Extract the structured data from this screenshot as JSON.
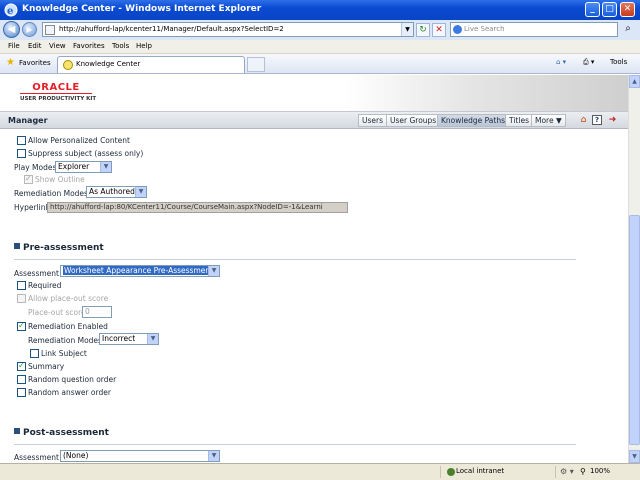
{
  "window": {
    "title": "Knowledge Center - Windows Internet Explorer",
    "min_label": "_",
    "max_label": "□",
    "close_label": "✕"
  },
  "address": {
    "url": "http://ahufford-lap/kcenter11/Manager/Default.aspx?SelectID=2",
    "search_placeholder": "Live Search"
  },
  "menu": [
    "File",
    "Edit",
    "View",
    "Favorites",
    "Tools",
    "Help"
  ],
  "favorites": {
    "label": "Favorites",
    "tab_label": "Knowledge Center",
    "tools_label": "Tools"
  },
  "brand": {
    "logo_word": "ORACLE",
    "logo_sub": "USER PRODUCTIVITY KIT"
  },
  "manager": {
    "title": "Manager",
    "tabs": [
      {
        "label": "Users"
      },
      {
        "label": "User Groups"
      },
      {
        "label": "Knowledge Paths"
      },
      {
        "label": "Titles"
      },
      {
        "label": "More ▼"
      }
    ],
    "active_tab": "Knowledge Paths",
    "help_label": "?"
  },
  "settings": {
    "allow_personalized_label": "Allow Personalized Content",
    "suppress_subject_label": "Suppress subject (assess only)",
    "play_modes_label": "Play Modes",
    "play_modes_value": "Explorer",
    "show_outline_label": "Show Outline",
    "remediation_modes_label": "Remediation Modes",
    "remediation_modes_value": "As Authored",
    "hyperlink_label": "Hyperlink",
    "hyperlink_value": "http://ahufford-lap:80/KCenter11/Course/CourseMain.aspx?NodeID=-1&Learni"
  },
  "pre_assessment": {
    "heading": "Pre-assessment",
    "assessment_label": "Assessment",
    "assessment_value": "Worksheet Appearance Pre-Assessment",
    "required_label": "Required",
    "allow_placeout_label": "Allow place-out score",
    "placeout_score_label": "Place-out score",
    "placeout_score_value": "0",
    "remediation_enabled_label": "Remediation Enabled",
    "remediation_modes_label": "Remediation Modes",
    "remediation_modes_value": "Incorrect",
    "link_subject_label": "Link Subject",
    "summary_label": "Summary",
    "random_question_label": "Random question order",
    "random_answer_label": "Random answer order"
  },
  "post_assessment": {
    "heading": "Post-assessment",
    "assessment_label": "Assessment",
    "assessment_value": "(None)"
  },
  "status": {
    "zone": "Local intranet",
    "zoom": "100%"
  }
}
